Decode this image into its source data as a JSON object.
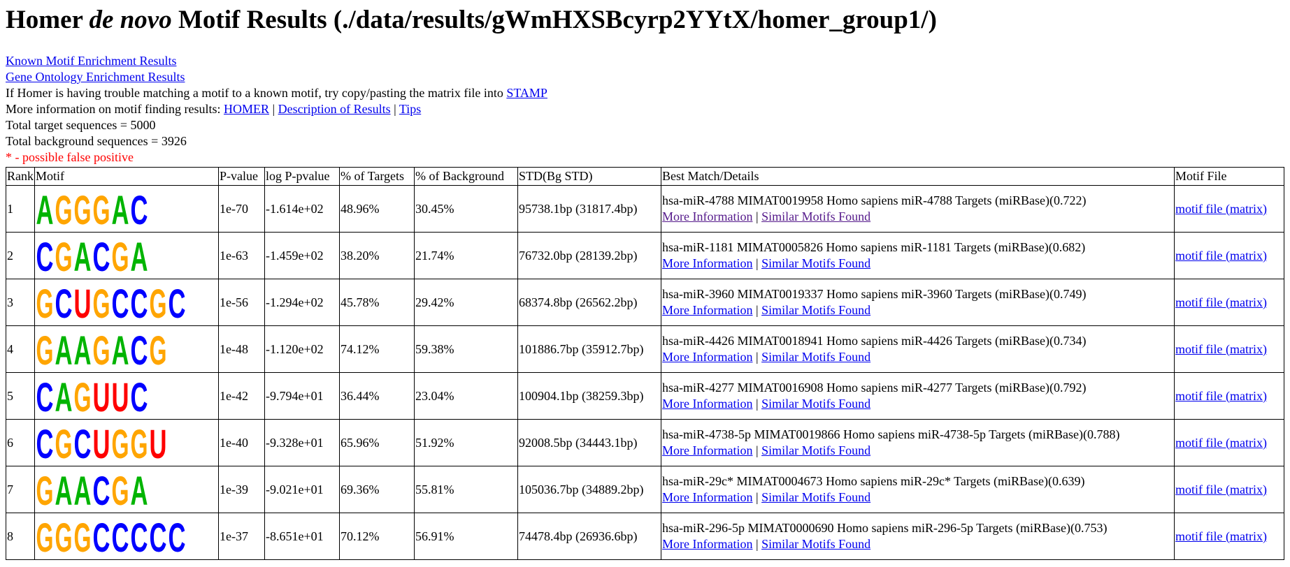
{
  "title": {
    "prefix": "Homer ",
    "italic": "de novo",
    "suffix": " Motif Results (./data/results/gWmHXSBcyrp2YYtX/homer_group1/)"
  },
  "links": {
    "known": "Known Motif Enrichment Results",
    "go": "Gene Ontology Enrichment Results"
  },
  "stamp": {
    "text": "If Homer is having trouble matching a motif to a known motif, try copy/pasting the matrix file into ",
    "link": "STAMP"
  },
  "more_info": {
    "text": "More information on motif finding results: ",
    "homer": "HOMER",
    "sep": " | ",
    "description": "Description of Results",
    "tips": "Tips"
  },
  "totals": {
    "target": "Total target sequences = 5000",
    "background": "Total background sequences = 3926"
  },
  "false_positive_note": "* - possible false positive",
  "colors": {
    "A": "#00b400",
    "C": "#0000ff",
    "G": "#ffa500",
    "U": "#ff0000"
  },
  "table": {
    "headers": [
      "Rank",
      "Motif",
      "P-value",
      "log P-pvalue",
      "% of Targets",
      "% of Background",
      "STD(Bg STD)",
      "Best Match/Details",
      "Motif File"
    ],
    "more_info_label": "More Information",
    "similar_label": "Similar Motifs Found",
    "details_sep": " | ",
    "motif_file_label": "motif file (matrix)",
    "rows": [
      {
        "rank": "1",
        "pvalue": "1e-70",
        "logp": "-1.614e+02",
        "targets": "48.96%",
        "background": "30.45%",
        "std": "95738.1bp (31817.4bp)",
        "match": "hsa-miR-4788 MIMAT0019958 Homo sapiens miR-4788 Targets (miRBase)(0.722)",
        "logo": "AGGGAC",
        "more_visited": true
      },
      {
        "rank": "2",
        "pvalue": "1e-63",
        "logp": "-1.459e+02",
        "targets": "38.20%",
        "background": "21.74%",
        "std": "76732.0bp (28139.2bp)",
        "match": "hsa-miR-1181 MIMAT0005826 Homo sapiens miR-1181 Targets (miRBase)(0.682)",
        "logo": "CGACGA",
        "more_visited": false
      },
      {
        "rank": "3",
        "pvalue": "1e-56",
        "logp": "-1.294e+02",
        "targets": "45.78%",
        "background": "29.42%",
        "std": "68374.8bp (26562.2bp)",
        "match": "hsa-miR-3960 MIMAT0019337 Homo sapiens miR-3960 Targets (miRBase)(0.749)",
        "logo": "GCUGCCGC",
        "more_visited": false
      },
      {
        "rank": "4",
        "pvalue": "1e-48",
        "logp": "-1.120e+02",
        "targets": "74.12%",
        "background": "59.38%",
        "std": "101886.7bp (35912.7bp)",
        "match": "hsa-miR-4426 MIMAT0018941 Homo sapiens miR-4426 Targets (miRBase)(0.734)",
        "logo": "GAAGACG",
        "more_visited": false
      },
      {
        "rank": "5",
        "pvalue": "1e-42",
        "logp": "-9.794e+01",
        "targets": "36.44%",
        "background": "23.04%",
        "std": "100904.1bp (38259.3bp)",
        "match": "hsa-miR-4277 MIMAT0016908 Homo sapiens miR-4277 Targets (miRBase)(0.792)",
        "logo": "CAGUUC",
        "more_visited": false
      },
      {
        "rank": "6",
        "pvalue": "1e-40",
        "logp": "-9.328e+01",
        "targets": "65.96%",
        "background": "51.92%",
        "std": "92008.5bp (34443.1bp)",
        "match": "hsa-miR-4738-5p MIMAT0019866 Homo sapiens miR-4738-5p Targets (miRBase)(0.788)",
        "logo": "CGCUGGU",
        "more_visited": false
      },
      {
        "rank": "7",
        "pvalue": "1e-39",
        "logp": "-9.021e+01",
        "targets": "69.36%",
        "background": "55.81%",
        "std": "105036.7bp (34889.2bp)",
        "match": "hsa-miR-29c* MIMAT0004673 Homo sapiens miR-29c* Targets (miRBase)(0.639)",
        "logo": "GAACGA",
        "more_visited": false
      },
      {
        "rank": "8",
        "pvalue": "1e-37",
        "logp": "-8.651e+01",
        "targets": "70.12%",
        "background": "56.91%",
        "std": "74478.4bp (26936.6bp)",
        "match": "hsa-miR-296-5p MIMAT0000690 Homo sapiens miR-296-5p Targets (miRBase)(0.753)",
        "logo": "GGGCCCCC",
        "more_visited": false
      }
    ]
  }
}
